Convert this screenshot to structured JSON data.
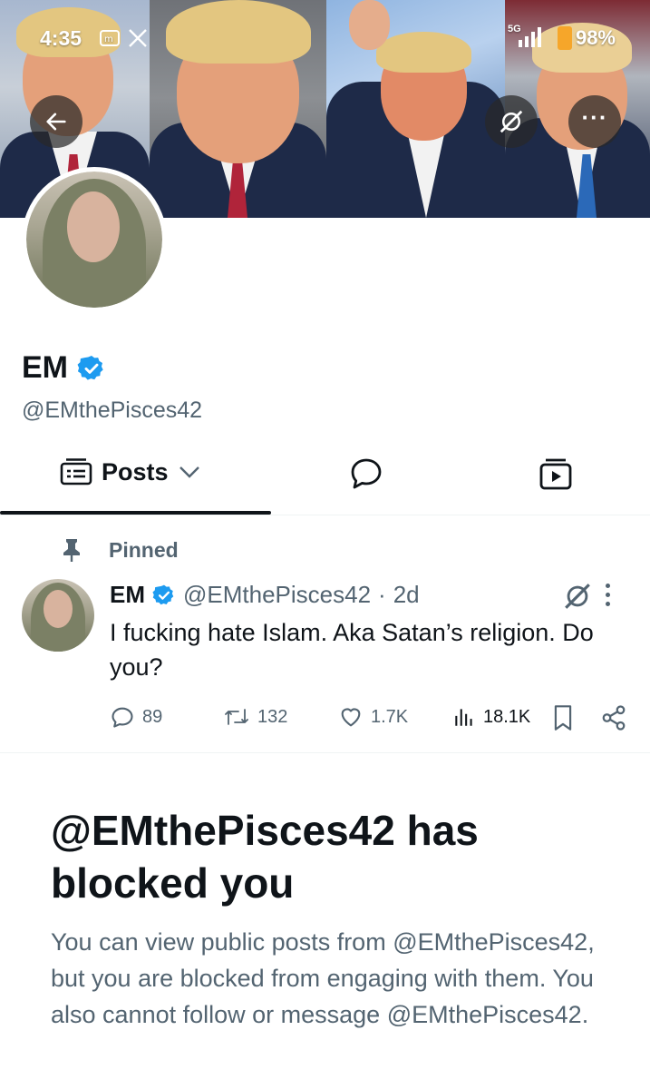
{
  "status_bar": {
    "time": "4:35",
    "network": "5G",
    "battery": "98%"
  },
  "profile": {
    "display_name": "EM",
    "handle": "@EMthePisces42",
    "verified": true
  },
  "tabs": {
    "posts_label": "Posts"
  },
  "pinned_post": {
    "pinned_label": "Pinned",
    "author_name": "EM",
    "author_handle": "@EMthePisces42",
    "separator": "·",
    "time_ago": "2d",
    "text": "I fucking hate Islam. Aka Satan’s religion. Do you?",
    "replies": "89",
    "reposts": "132",
    "likes": "1.7K",
    "views": "18.1K"
  },
  "blocked": {
    "title": "@EMthePisces42 has blocked you",
    "description": "You can view public posts from @EMthePisces42, but you are blocked from engaging with them. You also cannot follow or message @EMthePisces42."
  },
  "colors": {
    "verified_blue": "#1d9bf0",
    "text_primary": "#0f1419",
    "text_secondary": "#536471",
    "battery": "#f6a62a"
  },
  "icons": [
    "back-arrow-icon",
    "grok-icon",
    "more-icon",
    "verified-badge-icon",
    "posts-tab-icon",
    "chevron-down-icon",
    "reply-bubble-icon",
    "media-tab-icon",
    "pin-icon",
    "reply-icon",
    "repost-icon",
    "like-icon",
    "views-icon",
    "bookmark-icon",
    "share-icon"
  ]
}
